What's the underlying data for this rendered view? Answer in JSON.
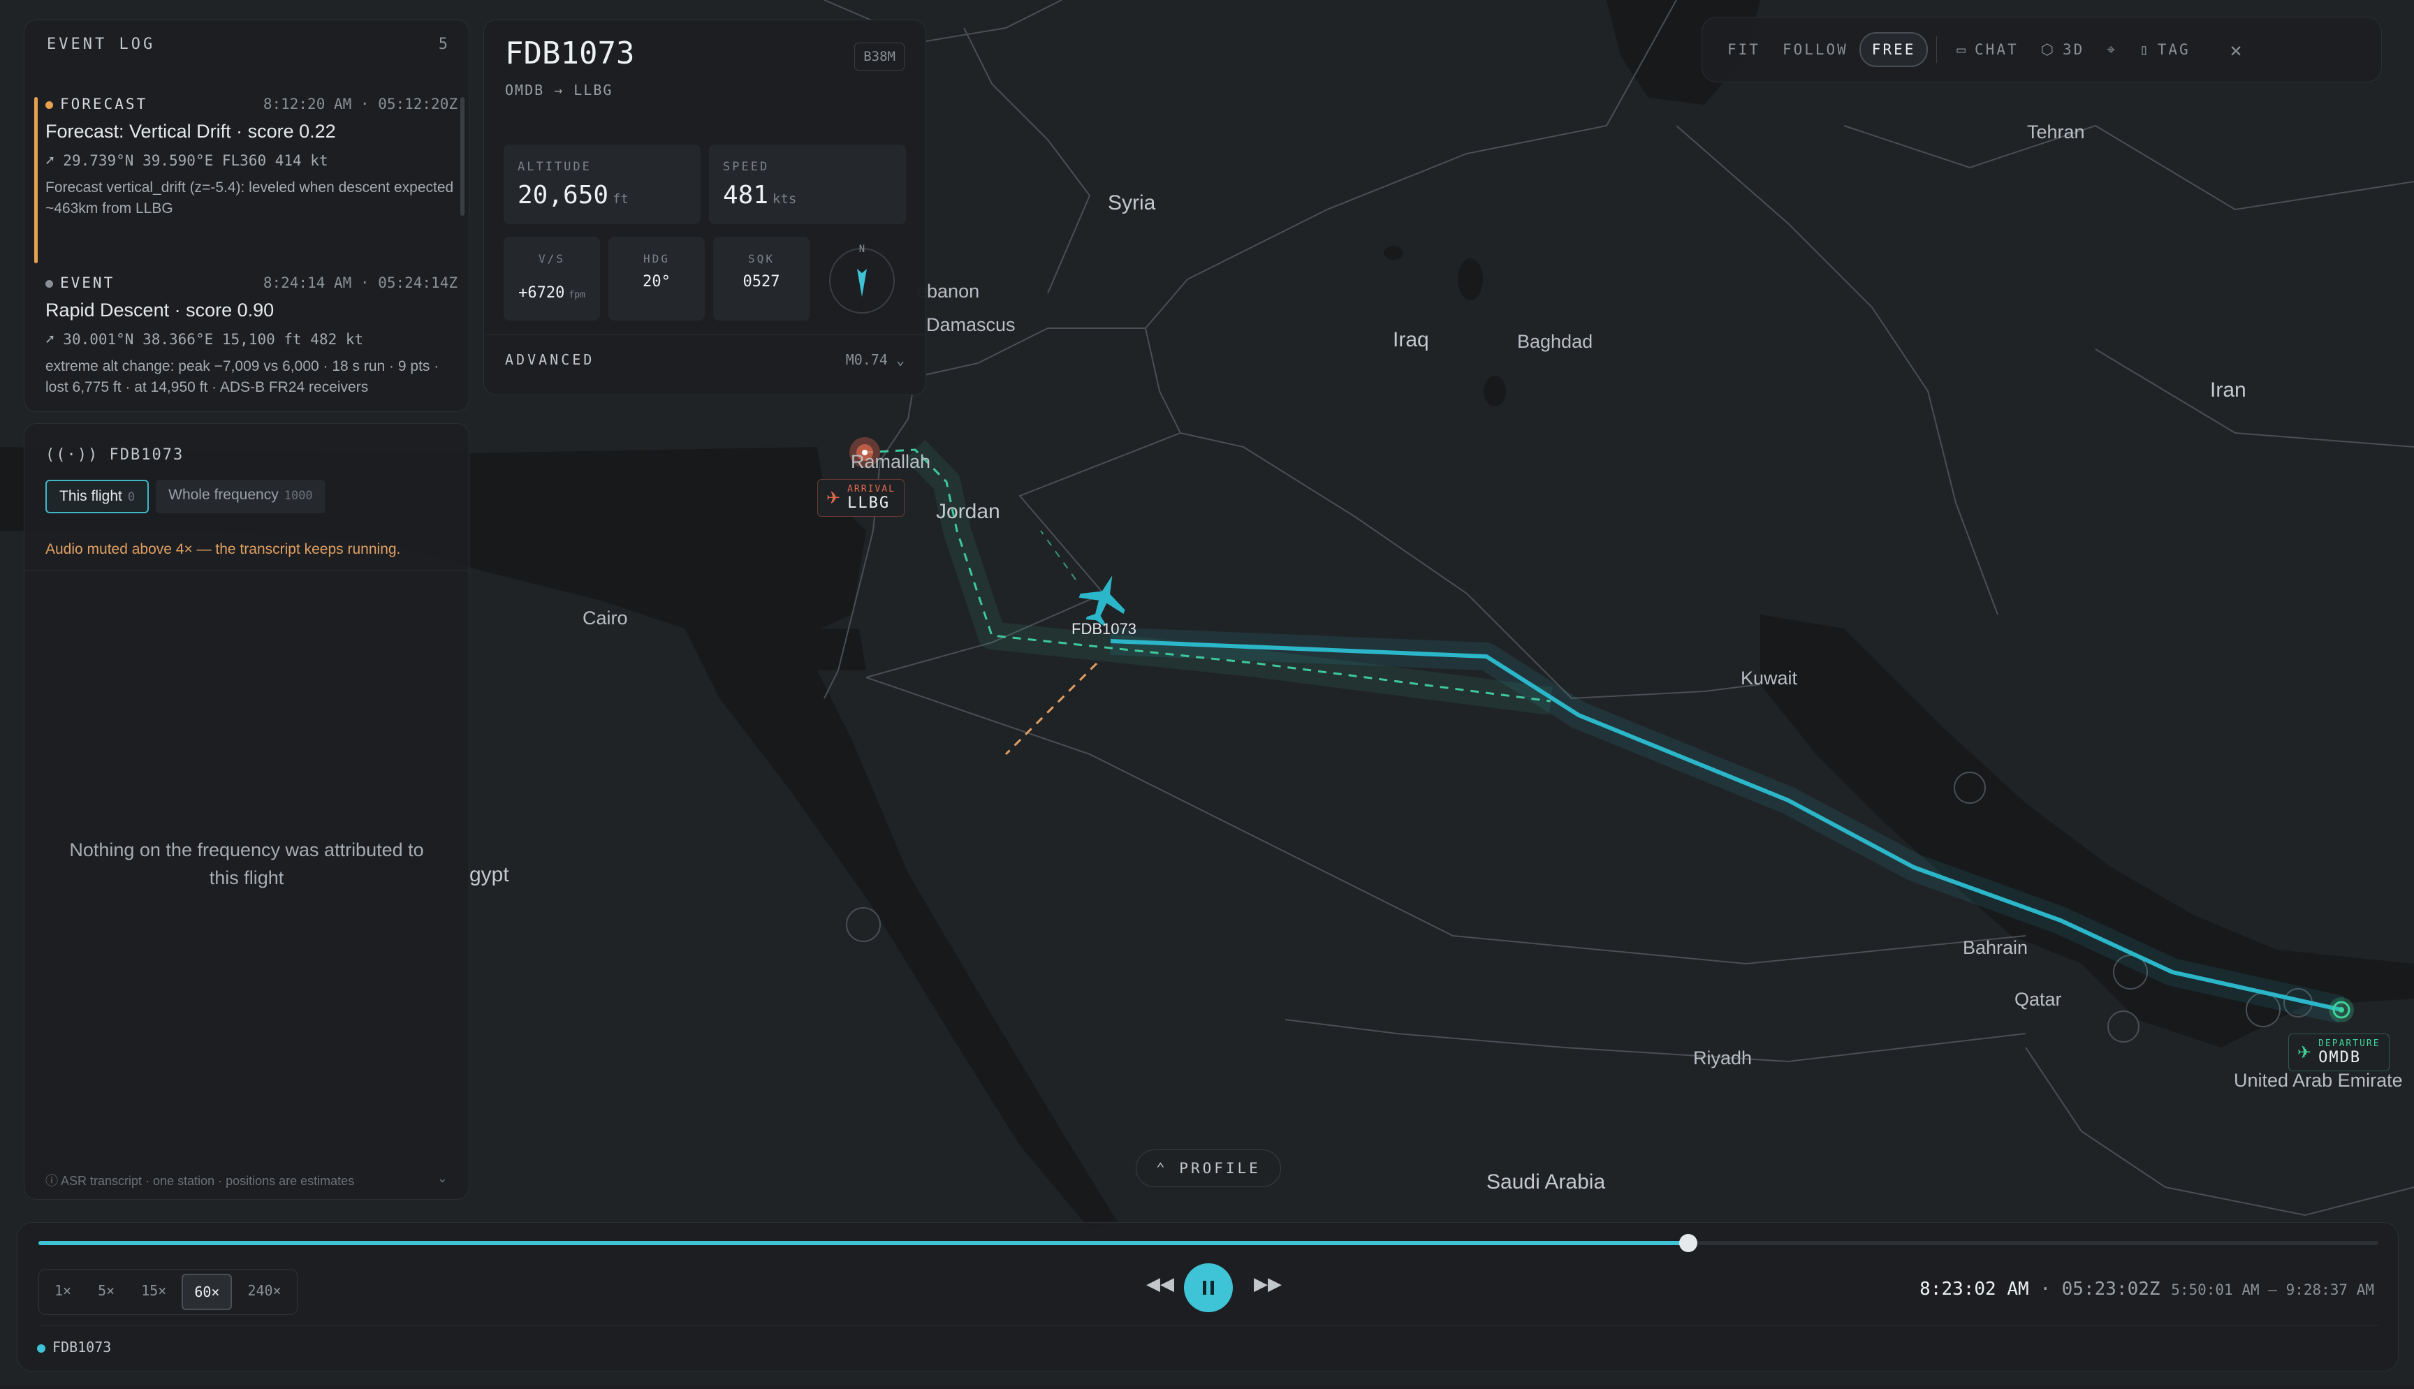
{
  "map": {
    "labels": {
      "syria": "Syria",
      "lebanon": "ebanon",
      "damascus": "Damascus",
      "iraq": "Iraq",
      "baghdad": "Baghdad",
      "tehran": "Tehran",
      "iran": "Iran",
      "ramallah": "Ramallah",
      "jordan": "Jordan",
      "cairo": "Cairo",
      "kuwait": "Kuwait",
      "egypt": "gypt",
      "bahrain": "Bahrain",
      "qatar": "Qatar",
      "riyadh": "Riyadh",
      "saudi_arabia": "Saudi Arabia",
      "uae": "United Arab Emirate"
    },
    "arrival": {
      "tag": "ARRIVAL",
      "code": "LLBG",
      "color": "#e26a4f"
    },
    "departure": {
      "tag": "DEPARTURE",
      "code": "OMDB",
      "color": "#3fd39a"
    },
    "aircraft_label": "FDB1073",
    "profile_button": "PROFILE",
    "colors": {
      "track": "#2bb7c9",
      "forecast": "#3fc99a",
      "drift": "#e0a063"
    }
  },
  "event_log": {
    "title": "EVENT LOG",
    "count": "5",
    "events": [
      {
        "kind": "FORECAST",
        "dot_color": "#e6a14f",
        "time": "8:12:20 AM · 05:12:20Z",
        "title": "Forecast: Vertical Drift · score 0.22",
        "pos": "29.739°N 39.590°E FL360 414 kt",
        "desc": "Forecast vertical_drift (z=-5.4): leveled when descent expected ~463km from LLBG"
      },
      {
        "kind": "EVENT",
        "dot_color": "#8a9096",
        "time": "8:24:14 AM · 05:24:14Z",
        "title": "Rapid Descent · score 0.90",
        "pos": "30.001°N 38.366°E 15,100 ft 482 kt",
        "desc": "extreme alt change: peak −7,009 vs 6,000 · 18 s run · 9 pts · lost 6,775 ft · at 14,950 ft · ADS-B FR24 receivers"
      }
    ]
  },
  "frequency": {
    "title": "FDB1073",
    "tabs": [
      {
        "label": "This flight",
        "count": "0"
      },
      {
        "label": "Whole frequency",
        "count": "1000"
      }
    ],
    "note": "Audio muted above 4× — the transcript keeps running.",
    "empty": "Nothing on the frequency was attributed to this flight",
    "footer": "ASR transcript · one station · positions are estimates"
  },
  "flight": {
    "callsign": "FDB1073",
    "type": "B38M",
    "route": "OMDB → LLBG",
    "altitude": {
      "label": "ALTITUDE",
      "value": "20,650",
      "unit": "ft"
    },
    "speed": {
      "label": "SPEED",
      "value": "481",
      "unit": "kts"
    },
    "vs": {
      "label": "V/S",
      "value": "+6720",
      "unit": "fpm"
    },
    "hdg": {
      "label": "HDG",
      "value": "20°"
    },
    "sqk": {
      "label": "SQK",
      "value": "0527"
    },
    "compass_n": "N",
    "advanced": "ADVANCED",
    "mach": "M0.74"
  },
  "toolbar": {
    "fit": "FIT",
    "follow": "FOLLOW",
    "free": "FREE",
    "chat": "CHAT",
    "three_d": "3D",
    "tag": "TAG"
  },
  "timeline": {
    "progress": 0.705,
    "speeds": [
      "1×",
      "5×",
      "15×",
      "60×",
      "240×"
    ],
    "active_speed": "60×",
    "local_time": "8:23:02 AM",
    "zulu_time": "05:23:02Z",
    "range": "5:50:01 AM – 9:28:37 AM",
    "flight": "FDB1073",
    "accent": "#3fc3d6"
  }
}
